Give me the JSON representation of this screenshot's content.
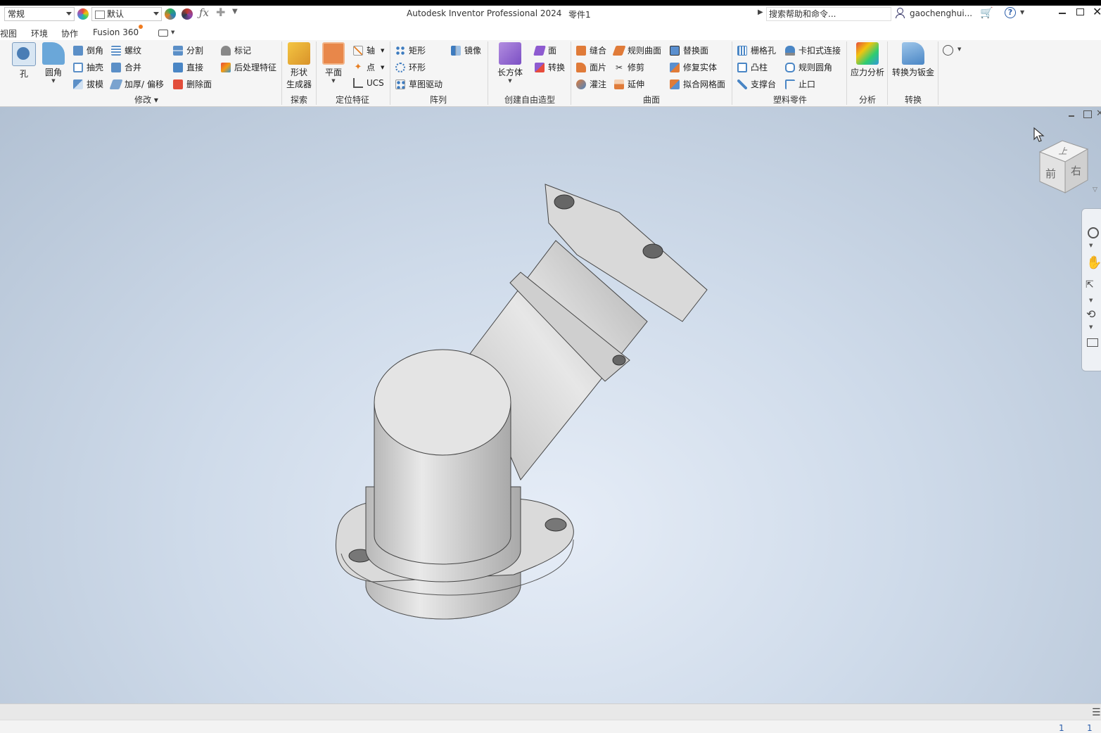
{
  "titlebar": {
    "style_select": "常规",
    "appearance_select": "默认",
    "app_title": "Autodesk Inventor Professional 2024",
    "document": "零件1",
    "search_placeholder": "搜索帮助和命令...",
    "user": "gaochenghui..."
  },
  "tabs": [
    "视图",
    "环境",
    "协作",
    "Fusion 360"
  ],
  "ribbon": {
    "modify": {
      "hole": "孔",
      "fillet": "圆角",
      "chamfer": "倒角",
      "thread": "螺纹",
      "split": "分割",
      "mark": "标记",
      "shell": "抽壳",
      "combine": "合并",
      "direct": "直接",
      "post_process": "后处理特征",
      "draft": "拔模",
      "thicken": "加厚/ 偏移",
      "delete_face": "删除面",
      "label": "修改"
    },
    "explore": {
      "shape_gen_1": "形状",
      "shape_gen_2": "生成器",
      "label": "探索"
    },
    "work_features": {
      "plane": "平面",
      "axis": "轴",
      "point": "点",
      "ucs": "UCS",
      "label": "定位特征"
    },
    "pattern": {
      "rect": "矩形",
      "mirror": "镜像",
      "circular": "环形",
      "sketch_driven": "草图驱动",
      "label": "阵列"
    },
    "freeform": {
      "box": "长方体",
      "face": "面",
      "convert": "转换",
      "label": "创建自由造型"
    },
    "surface": {
      "stitch": "缝合",
      "ruled": "规则曲面",
      "replace": "替换面",
      "patch": "面片",
      "trim": "修剪",
      "repair": "修复实体",
      "sculpt": "灌注",
      "extend": "延伸",
      "fit_mesh": "拟合网格面",
      "label": "曲面"
    },
    "plastic": {
      "grill": "栅格孔",
      "snap": "卡扣式连接",
      "boss": "凸柱",
      "rule_fillet": "规则圆角",
      "rest": "支撑台",
      "lip": "止口",
      "label": "塑料零件"
    },
    "analysis": {
      "stress": "应力分析",
      "label": "分析"
    },
    "convert": {
      "to_sheet_metal": "转换为钣金",
      "label": "转换"
    }
  },
  "viewcube": {
    "top": "上",
    "front": "前",
    "right": "右"
  },
  "status": {
    "count1": "1",
    "count2": "1"
  },
  "colors": {
    "accent": "#f07b1f",
    "ribbon_bg": "#f5f5f5",
    "viewport_bg": "#cfdbea"
  }
}
